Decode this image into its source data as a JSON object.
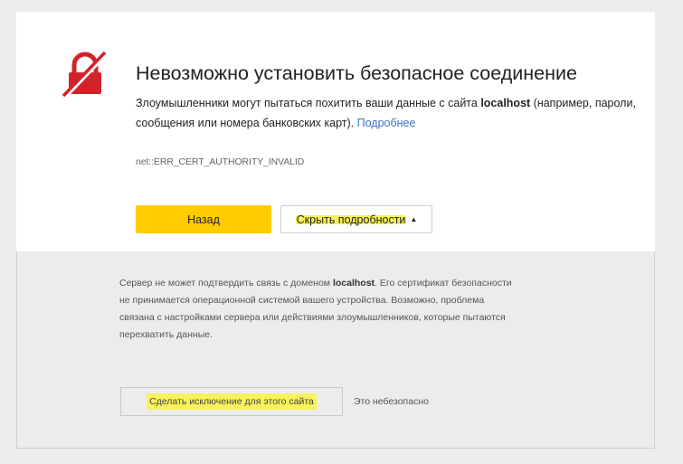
{
  "error": {
    "title": "Невозможно установить безопасное соединение",
    "desc_before": "Злоумышленники могут пытаться похитить ваши данные с сайта ",
    "host": "localhost",
    "desc_after": " (например, пароли, сообщения или номера банковских карт). ",
    "more_link": "Подробнее",
    "code": "net::ERR_CERT_AUTHORITY_INVALID",
    "icon": "broken-lock-icon",
    "icon_color": "#d2232a"
  },
  "actions": {
    "back_label": "Назад",
    "details_label": "Скрыть подробности",
    "details_caret": "▲",
    "back_color": "#ffcc00"
  },
  "details": {
    "text_before": "Сервер не может подтвердить связь с доменом ",
    "host": "localhost",
    "text_after": ". Его сертификат безопасности не принимается операционной системой вашего устройства. Возможно, проблема связана с настройками сервера или действиями злоумышленников, которые пытаются перехватить данные.",
    "exception_label": "Сделать исключение для этого сайта",
    "unsafe_note": "Это небезопасно"
  },
  "highlight_color": "#f8f25b"
}
